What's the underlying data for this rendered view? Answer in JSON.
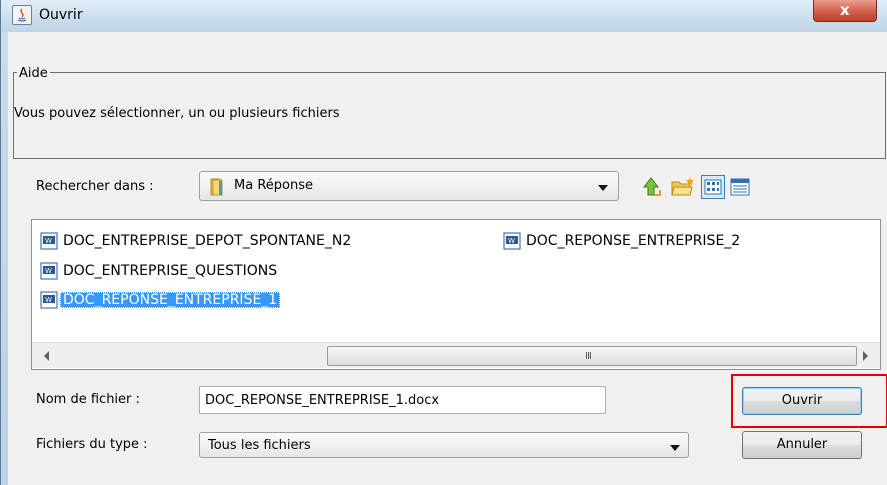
{
  "window": {
    "title": "Ouvrir",
    "close_label": "x"
  },
  "aide": {
    "legend": "Aide",
    "text": "Vous pouvez sélectionner, un ou plusieurs fichiers"
  },
  "look_in": {
    "label": "Rechercher dans :",
    "value": "Ma Réponse",
    "icon": "folder-icon"
  },
  "toolbar": {
    "icons": [
      "up-folder-icon",
      "new-folder-icon",
      "list-view-icon",
      "details-view-icon"
    ]
  },
  "files": [
    {
      "name": "DOC_ENTREPRISE_DEPOT_SPONTANE_N2",
      "icon": "word-doc-icon",
      "selected": false
    },
    {
      "name": "DOC_ENTREPRISE_QUESTIONS",
      "icon": "word-doc-icon",
      "selected": false
    },
    {
      "name": "DOC_REPONSE_ENTREPRISE_1",
      "icon": "word-doc-icon",
      "selected": true
    },
    {
      "name": "DOC_REPONSE_ENTREPRISE_2",
      "icon": "word-doc-icon",
      "selected": false
    }
  ],
  "scrollbar": {
    "grip": "III"
  },
  "filename": {
    "label": "Nom de fichier :",
    "value": "DOC_REPONSE_ENTREPRISE_1.docx"
  },
  "filetype": {
    "label": "Fichiers du type :",
    "value": "Tous les fichiers"
  },
  "buttons": {
    "open": "Ouvrir",
    "cancel": "Annuler"
  },
  "colors": {
    "selection": "#3399ff",
    "highlight_box": "#e00000",
    "close_button": "#c0402c"
  }
}
